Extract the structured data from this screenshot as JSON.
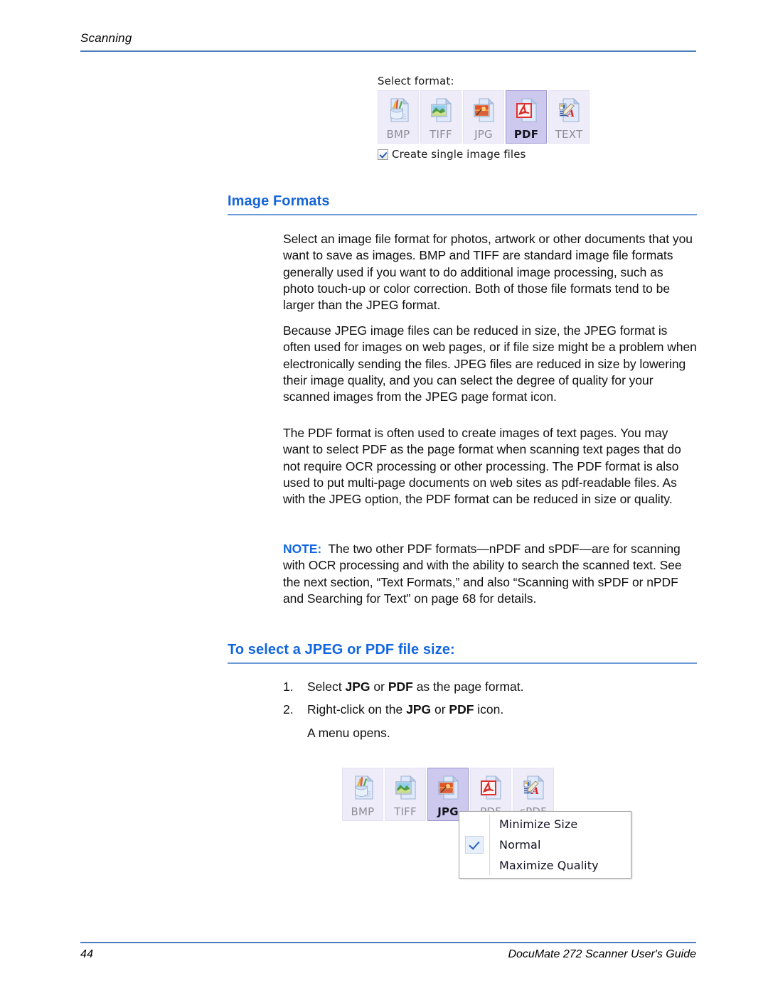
{
  "header": {
    "running_head": "Scanning"
  },
  "footer": {
    "page_number": "44",
    "guide_title": "DocuMate 272 Scanner User's Guide"
  },
  "widget_top": {
    "label": "Select format:",
    "tiles": [
      {
        "caption": "BMP",
        "icon": "bmp-file-icon",
        "selected": false
      },
      {
        "caption": "TIFF",
        "icon": "tiff-file-icon",
        "selected": false
      },
      {
        "caption": "JPG",
        "icon": "jpg-file-icon",
        "selected": false
      },
      {
        "caption": "PDF",
        "icon": "pdf-file-icon",
        "selected": true
      },
      {
        "caption": "TEXT",
        "icon": "text-file-icon",
        "selected": false
      }
    ],
    "checkbox": {
      "label": "Create single image files",
      "checked": true
    }
  },
  "widget_bottom": {
    "tiles": [
      {
        "caption": "BMP",
        "icon": "bmp-file-icon",
        "selected": false
      },
      {
        "caption": "TIFF",
        "icon": "tiff-file-icon",
        "selected": false
      },
      {
        "caption": "JPG",
        "icon": "jpg-file-icon",
        "selected": true
      },
      {
        "caption": "PDF",
        "icon": "pdf-file-icon",
        "selected": false
      },
      {
        "caption": "sPDF",
        "icon": "spdf-file-icon",
        "selected": false
      }
    ],
    "context_menu": {
      "items": [
        {
          "label": "Minimize Size",
          "checked": false
        },
        {
          "label": "Normal",
          "checked": true
        },
        {
          "label": "Maximize Quality",
          "checked": false
        }
      ]
    }
  },
  "sections": {
    "image_formats": {
      "heading": "Image Formats",
      "paragraphs": [
        "Select an image file format for photos, artwork or other documents that you want to save as images. BMP and TIFF are standard image file formats generally used if you want to do additional image processing, such as photo touch-up or color correction. Both of those file formats tend to be larger than the JPEG format.",
        "Because JPEG image files can be reduced in size, the JPEG format is often used for images on web pages, or if file size might be a problem when electronically sending the files. JPEG files are reduced in size by lowering their image quality, and you can select the degree of quality for your scanned images from the JPEG page format icon.",
        "The PDF format is often used to create images of text pages. You may want to select PDF as the page format when scanning text pages that do not require OCR processing or other processing. The PDF format is also used to put multi-page documents on web sites as pdf-readable files. As with the JPEG option, the PDF format can be reduced in size or quality."
      ],
      "note": {
        "tag": "NOTE:",
        "text": "The two other PDF formats—nPDF and sPDF—are for scanning with OCR processing and with the ability to search the scanned text. See the next section, “Text Formats,” and also “Scanning with sPDF or nPDF and Searching for Text” on page 68 for details."
      }
    },
    "file_size": {
      "heading": "To select a JPEG or PDF file size:",
      "steps": [
        {
          "number": "1.",
          "prefix": "Select ",
          "bold1": "JPG",
          "mid": " or ",
          "bold2": "PDF",
          "suffix": " as the page format."
        },
        {
          "number": "2.",
          "prefix": "Right-click on the ",
          "bold1": "JPG",
          "mid": " or ",
          "bold2": "PDF",
          "suffix": " icon."
        }
      ],
      "substep": "A menu opens."
    }
  },
  "colors": {
    "heading_blue": "#1565d8",
    "rule_blue": "#4a7ebb",
    "tile_selected": "#cdc8ee",
    "tile_normal": "#eeecf8",
    "check_blue": "#2563c0"
  }
}
